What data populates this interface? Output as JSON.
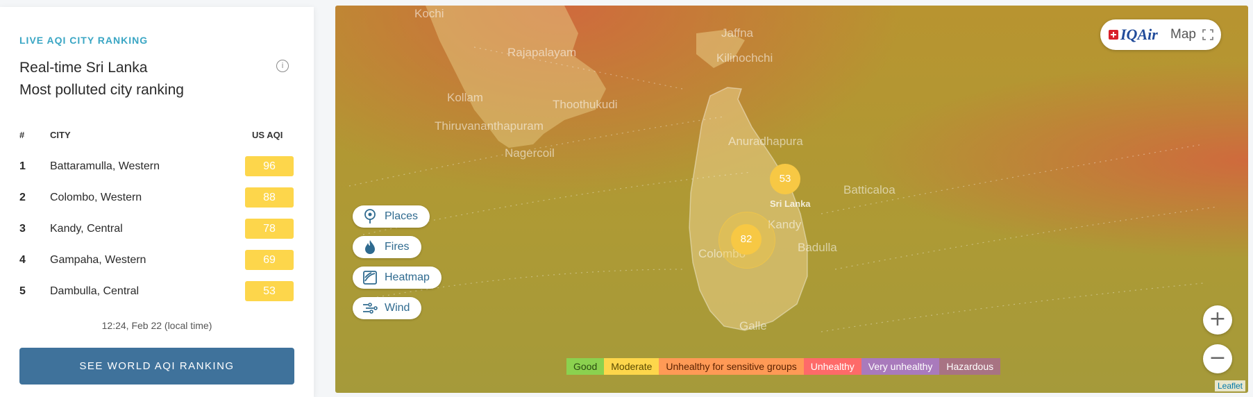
{
  "ranking": {
    "eyebrow": "LIVE AQI CITY RANKING",
    "title_line1": "Real-time Sri Lanka",
    "title_line2": "Most polluted city ranking",
    "info_icon": "info-icon",
    "columns": {
      "rank": "#",
      "city": "CITY",
      "aqi": "US AQI"
    },
    "rows": [
      {
        "rank": "1",
        "city": "Battaramulla, Western",
        "aqi": "96"
      },
      {
        "rank": "2",
        "city": "Colombo, Western",
        "aqi": "88"
      },
      {
        "rank": "3",
        "city": "Kandy, Central",
        "aqi": "78"
      },
      {
        "rank": "4",
        "city": "Gampaha, Western",
        "aqi": "69"
      },
      {
        "rank": "5",
        "city": "Dambulla, Central",
        "aqi": "53"
      }
    ],
    "updated": "12:24, Feb 22 (local time)",
    "world_button": "SEE WORLD AQI RANKING",
    "moderate_color": "#fdd64b",
    "button_color": "#3f729b"
  },
  "map": {
    "brand": {
      "logo": "IQAir",
      "label": "Map"
    },
    "places": {
      "kochi": "Kochi",
      "jaffna": "Jaffna",
      "kilinochchi": "Kilinochchi",
      "rajapalayam": "Rajapalayam",
      "kollam": "Kollam",
      "thoothukudi": "Thoothukudi",
      "thiruvananthapuram": "Thiruvananthapuram",
      "nagercoil": "Nagercoil",
      "anuradhapura": "Anuradhapura",
      "batticaloa": "Batticaloa",
      "kandy": "Kandy",
      "badulla": "Badulla",
      "colombo": "Colombo",
      "galle": "Galle"
    },
    "country_label": "Sri Lanka",
    "markers": [
      {
        "name": "sri-lanka-cluster",
        "aqi": "53"
      },
      {
        "name": "colombo-cluster",
        "aqi": "82"
      }
    ],
    "controls": {
      "places": "Places",
      "fires": "Fires",
      "heatmap": "Heatmap",
      "wind": "Wind"
    },
    "legend": [
      {
        "label": "Good",
        "color": "#8bd14f"
      },
      {
        "label": "Moderate",
        "color": "#fdd64b"
      },
      {
        "label": "Unhealthy for sensitive groups",
        "color": "#ff9a56"
      },
      {
        "label": "Unhealthy",
        "color": "#fe6a69"
      },
      {
        "label": "Very unhealthy",
        "color": "#a97abc"
      },
      {
        "label": "Hazardous",
        "color": "#a87383"
      }
    ],
    "zoom_in": "+",
    "zoom_out": "−",
    "attribution": "Leaflet"
  }
}
